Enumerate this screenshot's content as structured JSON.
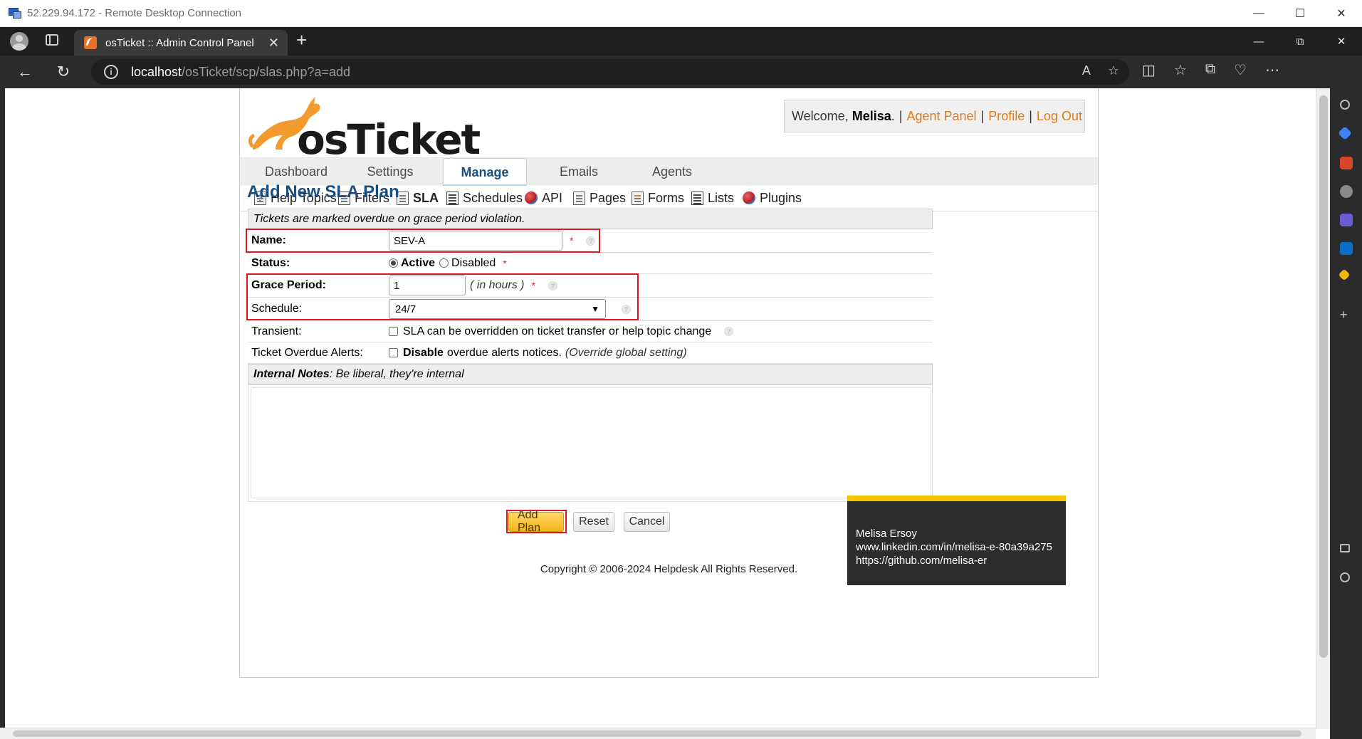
{
  "rdp": {
    "title": "52.229.94.172 - Remote Desktop Connection",
    "min": "—",
    "max": "☐",
    "close": "✕"
  },
  "browser": {
    "tab_title": "osTicket :: Admin Control Panel",
    "tab_close": "✕",
    "new_tab": "+",
    "win_min": "—",
    "win_max": "⧉",
    "win_close": "✕",
    "url_host": "localhost",
    "url_path": "/osTicket/scp/slas.php?a=add",
    "back": "←",
    "reload": "↻"
  },
  "header": {
    "logo_text": "osTicket",
    "welcome_prefix": "Welcome,",
    "user_name": "Melisa",
    "period": ".",
    "agent_panel": "Agent Panel",
    "profile": "Profile",
    "logout": "Log Out",
    "sep": "|"
  },
  "nav": {
    "tabs": [
      "Dashboard",
      "Settings",
      "Manage",
      "Emails",
      "Agents"
    ],
    "active_tab": "Manage",
    "sub_tabs": [
      "Help Topics",
      "Filters",
      "SLA",
      "Schedules",
      "API",
      "Pages",
      "Forms",
      "Lists",
      "Plugins"
    ],
    "active_sub_tab": "SLA"
  },
  "form": {
    "heading": "Add New SLA Plan",
    "header_note": "Tickets are marked overdue on grace period violation.",
    "name_label": "Name:",
    "name_value": "SEV-A",
    "status_label": "Status:",
    "status_active": "Active",
    "status_disabled": "Disabled",
    "grace_label": "Grace Period:",
    "grace_value": "1",
    "grace_hint": "( in hours )",
    "schedule_label": "Schedule:",
    "schedule_value": "24/7",
    "transient_label": "Transient:",
    "transient_text": "SLA can be overridden on ticket transfer or help topic change",
    "overdue_label": "Ticket Overdue Alerts:",
    "overdue_bold": "Disable",
    "overdue_text": "overdue alerts notices.",
    "overdue_note": "(Override global setting)",
    "notes_title": "Internal Notes",
    "notes_hint": ": Be liberal, they're internal",
    "required_mark": "*",
    "status": "Active"
  },
  "buttons": {
    "add": "Add Plan",
    "reset": "Reset",
    "cancel": "Cancel"
  },
  "footer": {
    "copyright": "Copyright © 2006-2024 Helpdesk All Rights Reserved."
  },
  "watermark": {
    "name": "Melisa Ersoy",
    "linkedin": "www.linkedin.com/in/melisa-e-80a39a275",
    "github": "https://github.com/melisa-er"
  },
  "colors": {
    "brand_blue": "#184e81",
    "link_orange": "#e07a1b",
    "highlight_red": "#e0161f",
    "primary_button": "#f5b41b"
  }
}
